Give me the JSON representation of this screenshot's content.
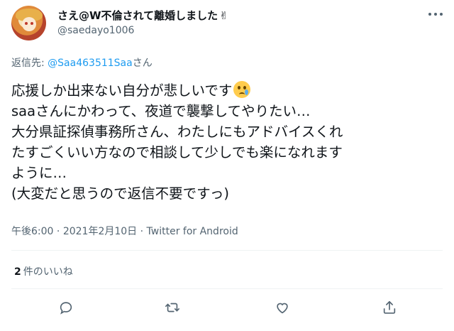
{
  "author": {
    "display_name": "さえ@W不倫されて離婚しました",
    "display_emoji": "✌",
    "handle": "@saedayo1006"
  },
  "reply": {
    "prefix": "返信先: ",
    "mention": "@Saa463511Saa",
    "suffix": "さん"
  },
  "tweet": {
    "lines": [
      "応援しか出来ない自分が悲しいです",
      "saaさんにかわって、夜道で襲撃してやりたい…",
      "大分県証探偵事務所さん、わたしにもアドバイスくれ",
      "たすごくいい方なので相談して少しでも楽になれます",
      "ように…",
      "(大変だと思うので返信不要ですっ)"
    ],
    "emoji_after_line_1": "crying-face-icon"
  },
  "meta": {
    "time": "午後6:00",
    "separator1": " · ",
    "date": "2021年2月10日",
    "separator2": " · ",
    "client": "Twitter for Android"
  },
  "likes": {
    "count": "2",
    "label": "件のいいね"
  },
  "actions": [
    "reply-icon",
    "retweet-icon",
    "like-icon",
    "share-icon"
  ],
  "colors": {
    "text": "#0f1419",
    "secondary": "#536471",
    "link": "#1d9bf0",
    "divider": "#eff3f4"
  }
}
